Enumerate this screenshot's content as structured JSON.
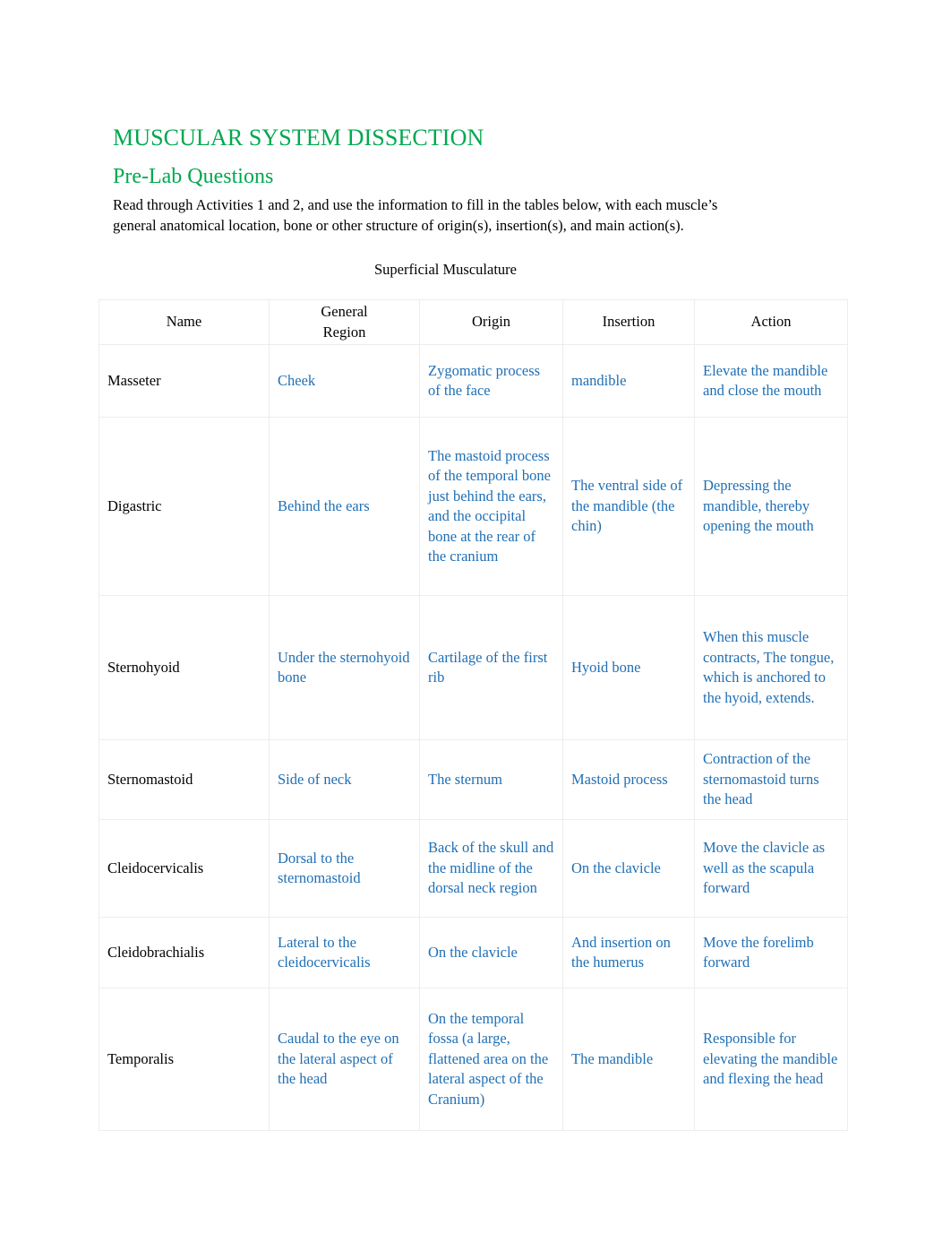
{
  "document": {
    "title": "MUSCULAR SYSTEM DISSECTION",
    "subtitle": "Pre-Lab Questions",
    "intro": "Read through Activities 1 and 2, and use the information to fill in the tables below, with each muscle’s general anatomical location, bone or other structure of origin(s), insertion(s), and main action(s).",
    "table_caption": "Superficial Musculature"
  },
  "colors": {
    "heading_green": "#00A84F",
    "answer_blue": "#1F6FB5",
    "body_black": "#000000",
    "table_border": "#EDEDED",
    "page_background": "#FFFFFF"
  },
  "table": {
    "columns": [
      "Name",
      "General\nRegion",
      "Origin",
      "Insertion",
      "Action"
    ],
    "headers": {
      "name": "Name",
      "region_line1": "General",
      "region_line2": "Region",
      "origin": "Origin",
      "insertion": "Insertion",
      "action": "Action"
    },
    "rows": [
      {
        "name": "Masseter",
        "region": "Cheek",
        "origin": "Zygomatic process of the face",
        "insertion": "mandible",
        "action": "Elevate the mandible and close the mouth"
      },
      {
        "name": "Digastric",
        "region": "Behind the ears",
        "origin": "The mastoid process of the temporal bone just behind the ears, and the occipital bone at the rear of the cranium",
        "insertion": "The ventral side of the mandible (the chin)",
        "action": "Depressing the mandible, thereby opening the mouth"
      },
      {
        "name": "Sternohyoid",
        "region": "Under the sternohyoid bone",
        "origin": "Cartilage of the first rib",
        "insertion": "Hyoid bone",
        "action": "When this muscle contracts, The tongue, which is anchored to the hyoid, extends."
      },
      {
        "name": "Sternomastoid",
        "region": "Side of neck",
        "origin": "The sternum",
        "insertion": "Mastoid process",
        "action": "Contraction of the sternomastoid turns the head"
      },
      {
        "name": "Cleidocervicalis",
        "region": "Dorsal to the sternomastoid",
        "origin": "Back of the skull and the midline of the dorsal neck region",
        "insertion": "On the clavicle",
        "action": "Move the clavicle as well as the scapula forward"
      },
      {
        "name": "Cleidobrachialis",
        "region": "Lateral to the cleidocervicalis",
        "origin": "On the clavicle",
        "insertion": "And insertion on the humerus",
        "action": "Move the forelimb forward"
      },
      {
        "name": "Temporalis",
        "region": "Caudal to the eye on the lateral aspect of the head",
        "origin": "On the temporal fossa (a large, flattened area on the lateral aspect of the Cranium)",
        "insertion": "The mandible",
        "action": "Responsible for elevating the mandible and flexing the head"
      }
    ]
  }
}
